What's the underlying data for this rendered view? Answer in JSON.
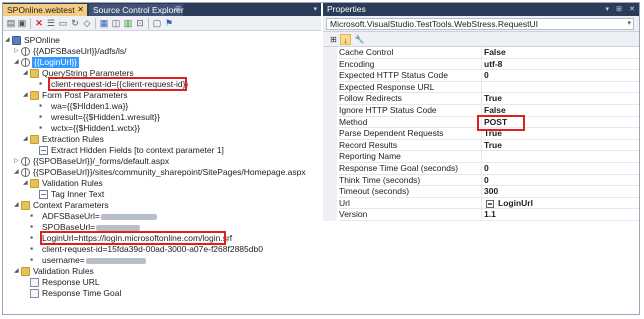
{
  "editor": {
    "tabs": [
      {
        "label": "SPOnline.webtest",
        "close": "✕"
      },
      {
        "label": "Source Control Explorer",
        "pin": "⊞"
      }
    ],
    "arrow": "▾"
  },
  "toolbar_icons": [
    "add-request-icon",
    "add-folder-icon",
    "delete-icon",
    "add-comment-icon",
    "add-transaction-icon",
    "add-loop-icon",
    "add-condition-icon",
    "generate-code-icon",
    "parameterize-icon",
    "add-datasource-icon",
    "add-plugin-icon",
    "set-credentials-icon",
    "run-icon",
    "properties-icon"
  ],
  "tree": [
    {
      "id": "root",
      "label": "SPOnline",
      "depth": 0,
      "icon": "root",
      "exp": "◢"
    },
    {
      "id": "adfs",
      "label": "{{ADFSBaseUrl}}/adfs/ls/",
      "depth": 1,
      "icon": "globe",
      "exp": "▷"
    },
    {
      "id": "loginurl",
      "label": "{{LoginUrl}}",
      "depth": 1,
      "icon": "globe",
      "exp": "◢",
      "selected": true
    },
    {
      "id": "qsparams",
      "label": "QueryString Parameters",
      "depth": 2,
      "icon": "folder",
      "exp": "◢"
    },
    {
      "id": "clientreq",
      "label": "client-request-id={{client-request-id}}",
      "depth": 3,
      "icon": "param"
    },
    {
      "id": "formpost",
      "label": "Form Post Parameters",
      "depth": 2,
      "icon": "folder",
      "exp": "◢"
    },
    {
      "id": "wa",
      "label": "wa={{$HIdden1.wa}}",
      "depth": 3,
      "icon": "param"
    },
    {
      "id": "wresult",
      "label": "wresult={{$Hidden1.wresult}}",
      "depth": 3,
      "icon": "param"
    },
    {
      "id": "wctx",
      "label": "wctx={{$Hidden1.wctx}}",
      "depth": 3,
      "icon": "param"
    },
    {
      "id": "extract",
      "label": "Extraction Rules",
      "depth": 2,
      "icon": "folder",
      "exp": "◢"
    },
    {
      "id": "exthidden",
      "label": "Extract Hidden Fields [to context parameter 1]",
      "depth": 3,
      "icon": "rule"
    },
    {
      "id": "forms",
      "label": "{{SPOBaseUrl}}/_forms/default.aspx",
      "depth": 1,
      "icon": "globe",
      "exp": "▷"
    },
    {
      "id": "homepage",
      "label": "{{SPOBaseUrl}}/sites/community_sharepoint/SitePages/Homepage.aspx",
      "depth": 1,
      "icon": "globe",
      "exp": "◢"
    },
    {
      "id": "valrules1",
      "label": "Validation Rules",
      "depth": 2,
      "icon": "folder",
      "exp": "◢"
    },
    {
      "id": "taginner",
      "label": "Tag Inner Text",
      "depth": 3,
      "icon": "rule"
    },
    {
      "id": "ctxparams",
      "label": "Context Parameters",
      "depth": 1,
      "icon": "folder",
      "exp": "◢"
    },
    {
      "id": "adfsbase",
      "label": "ADFSBaseUrl=",
      "depth": 2,
      "icon": "param",
      "blur": 56
    },
    {
      "id": "spobase",
      "label": "SPOBaseUrl=",
      "depth": 2,
      "icon": "param",
      "blur": 44
    },
    {
      "id": "loginurlparam",
      "label": "LoginUrl=https://login.microsoftonline.com/login.srf",
      "depth": 2,
      "icon": "param"
    },
    {
      "id": "clientreqparam",
      "label": "client-request-id=15fda39d-00ad-3000-a07e-f268f2885db0",
      "depth": 2,
      "icon": "param"
    },
    {
      "id": "username",
      "label": "username=",
      "depth": 2,
      "icon": "param",
      "blur": 60
    },
    {
      "id": "valrules2",
      "label": "Validation Rules",
      "depth": 1,
      "icon": "folder",
      "exp": "◢"
    },
    {
      "id": "responseurl",
      "label": "Response URL",
      "depth": 2,
      "icon": "page"
    },
    {
      "id": "responsetime",
      "label": "Response Time Goal",
      "depth": 2,
      "icon": "page"
    }
  ],
  "properties": {
    "title": "Properties",
    "title_controls": [
      "▾",
      "⊞",
      "✕"
    ],
    "object": "Microsoft.VisualStudio.TestTools.WebStress.RequestUI",
    "object_dd": "▾",
    "toolbar": [
      "⊞",
      "↓",
      "🔧"
    ],
    "rows": [
      {
        "name": "Cache Control",
        "value": "False"
      },
      {
        "name": "Encoding",
        "value": "utf-8"
      },
      {
        "name": "Expected HTTP Status Code",
        "value": "0"
      },
      {
        "name": "Expected Response URL",
        "value": ""
      },
      {
        "name": "Follow Redirects",
        "value": "True"
      },
      {
        "name": "Ignore HTTP Status Code",
        "value": "False"
      },
      {
        "name": "Method",
        "value": "POST"
      },
      {
        "name": "Parse Dependent Requests",
        "value": "True"
      },
      {
        "name": "Record Results",
        "value": "True"
      },
      {
        "name": "Reporting Name",
        "value": ""
      },
      {
        "name": "Response Time Goal (seconds)",
        "value": "0"
      },
      {
        "name": "Think Time (seconds)",
        "value": "0"
      },
      {
        "name": "Timeout (seconds)",
        "value": "300"
      },
      {
        "name": "Url",
        "value": "LoginUrl",
        "uri": true
      },
      {
        "name": "Version",
        "value": "1.1"
      }
    ]
  },
  "colors": {
    "accent_tab": "#f5cc84",
    "titlebar": "#2b3c59",
    "selection": "#3399ff",
    "highlight": "#e01f1f"
  }
}
